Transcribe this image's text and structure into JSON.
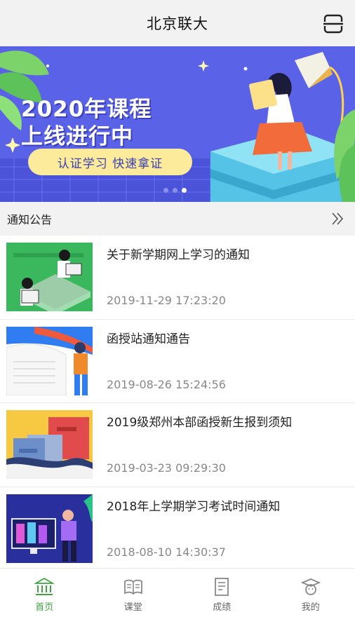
{
  "header": {
    "title": "北京联大",
    "scan_icon": "scan-icon"
  },
  "banner": {
    "line1": "2020年课程",
    "line2": "上线进行中",
    "tag": "认证学习   快速拿证",
    "colors": {
      "background": "#5a63e8",
      "pill": "#fbeb9a"
    }
  },
  "notice": {
    "label": "通知公告",
    "more_icon": "double-chevron-right-icon"
  },
  "notices": [
    {
      "title": "关于新学期网上学习的通知",
      "date": "2019-11-29 17:23:20"
    },
    {
      "title": "函授站通知通告",
      "date": "2019-08-26 15:24:56"
    },
    {
      "title": "2019级郑州本部函授新生报到须知",
      "date": "2019-03-23 09:29:30"
    },
    {
      "title": "2018年上学期学习考试时间通知",
      "date": "2018-08-10 14:30:37"
    }
  ],
  "tabs": [
    {
      "label": "首页",
      "icon": "bank-home-icon",
      "active": true
    },
    {
      "label": "课堂",
      "icon": "book-icon",
      "active": false
    },
    {
      "label": "成绩",
      "icon": "report-icon",
      "active": false
    },
    {
      "label": "我的",
      "icon": "graduate-cap-icon",
      "active": false
    }
  ],
  "accent_color": "#3fa63f"
}
